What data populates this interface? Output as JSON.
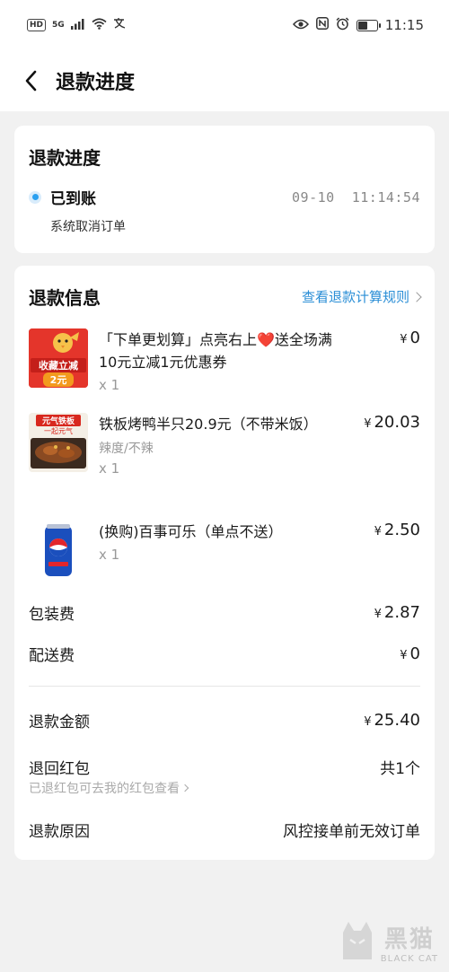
{
  "status_bar": {
    "hd": "HD",
    "network": "5G",
    "time": "11:15",
    "battery_level": 0.45,
    "nfc": "N"
  },
  "nav": {
    "title": "退款进度"
  },
  "progress_card": {
    "title": "退款进度",
    "status": "已到账",
    "time": "09-10  11:14:54",
    "desc": "系统取消订单"
  },
  "info_card": {
    "title": "退款信息",
    "rule_link": "查看退款计算规则",
    "items": [
      {
        "name": "「下单更划算」点亮右上❤️送全场满10元立减1元优惠券",
        "spec": "",
        "qty": "x 1",
        "price": "0",
        "thumb_text_1": "收藏立减",
        "thumb_text_2": "2元"
      },
      {
        "name": "铁板烤鸭半只20.9元（不带米饭）",
        "spec": "辣度/不辣",
        "qty": "x 1",
        "price": "20.03",
        "thumb_text_1": "元气铁板",
        "thumb_text_2": "一起元气"
      },
      {
        "name": "(换购)百事可乐（单点不送）",
        "spec": "",
        "qty": "x 1",
        "price": "2.50"
      }
    ],
    "currency": "¥",
    "packing_fee_label": "包装费",
    "packing_fee": "2.87",
    "delivery_fee_label": "配送费",
    "delivery_fee": "0",
    "refund_amount_label": "退款金额",
    "refund_amount": "25.40",
    "red_packet_label": "退回红包",
    "red_packet_count": "共1个",
    "red_packet_hint": "已退红包可去我的红包查看",
    "reason_label": "退款原因",
    "reason": "风控接单前无效订单"
  },
  "watermark": {
    "big": "黑猫",
    "small": "BLACK CAT"
  },
  "colors": {
    "accent": "#2a8ed6",
    "status_dot": "#2aa0f0",
    "background": "#f1f1f1"
  }
}
